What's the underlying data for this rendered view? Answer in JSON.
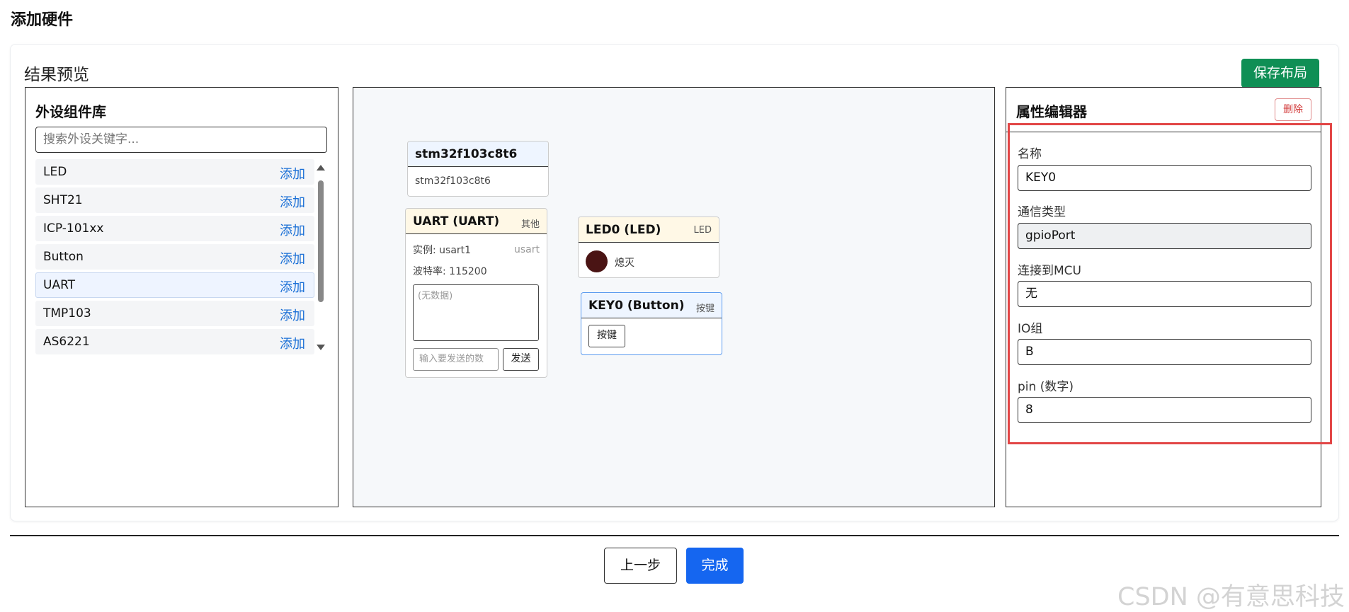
{
  "header": {
    "title": "添加硬件"
  },
  "card": {
    "title": "结果预览",
    "save_label": "保存布局"
  },
  "library": {
    "title": "外设组件库",
    "search_placeholder": "搜索外设关键字...",
    "add_label": "添加",
    "items": [
      {
        "name": "LED"
      },
      {
        "name": "SHT21"
      },
      {
        "name": "ICP-101xx"
      },
      {
        "name": "Button"
      },
      {
        "name": "UART",
        "selected": true
      },
      {
        "name": "TMP103"
      },
      {
        "name": "AS6221"
      }
    ]
  },
  "canvas": {
    "mcu": {
      "title": "stm32f103c8t6",
      "subtitle": "stm32f103c8t6"
    },
    "uart": {
      "title": "UART (UART)",
      "tag": "其他",
      "instance": "实例: usart1",
      "instance_tag": "usart",
      "baud": "波特率: 115200",
      "data_placeholder": "(无数据)",
      "send_placeholder": "输入要发送的数",
      "send_label": "发送"
    },
    "led": {
      "title": "LED0 (LED)",
      "tag": "LED",
      "state": "熄灭",
      "dot_color": "#4a1414"
    },
    "key": {
      "title": "KEY0 (Button)",
      "tag": "按键",
      "button_label": "按键"
    }
  },
  "properties": {
    "title": "属性编辑器",
    "delete_label": "删除",
    "fields": [
      {
        "label": "名称",
        "value": "KEY0"
      },
      {
        "label": "通信类型",
        "value": "gpioPort",
        "readonly": true
      },
      {
        "label": "连接到MCU",
        "value": "无"
      },
      {
        "label": "IO组",
        "value": "B"
      },
      {
        "label": "pin (数字)",
        "value": "8"
      }
    ]
  },
  "footer": {
    "prev_label": "上一步",
    "finish_label": "完成"
  },
  "watermark": "CSDN @有意思科技",
  "colors": {
    "save": "#0f8f55",
    "finish": "#1566f0",
    "add_link": "#1a6fd6",
    "highlight": "#e24646"
  }
}
